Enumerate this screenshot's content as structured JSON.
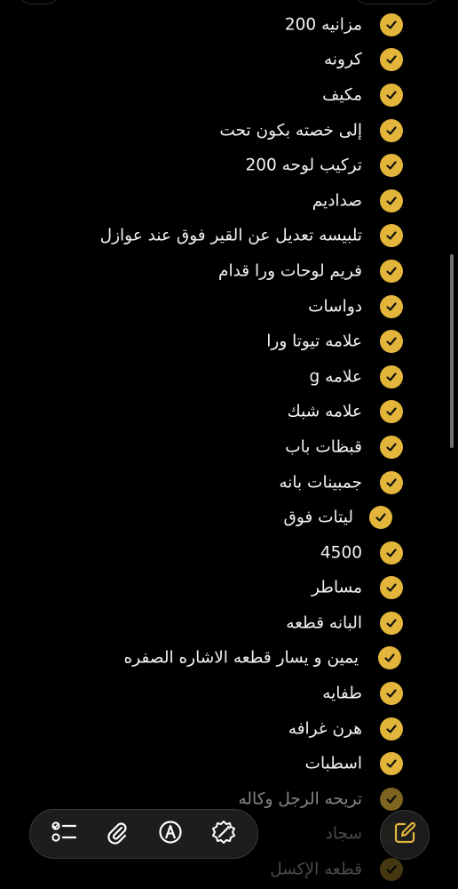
{
  "checklist": {
    "items": [
      {
        "label": "مزانيه 200"
      },
      {
        "label": "كرونه"
      },
      {
        "label": "مكيف"
      },
      {
        "label": "إلى خصته بكون تحت"
      },
      {
        "label": "تركيب لوحه 200"
      },
      {
        "label": "صداديم"
      },
      {
        "label": "تلبيسه تعديل عن القير فوق عند  عوازل"
      },
      {
        "label": "فريم لوحات ورا قدام"
      },
      {
        "label": "دواسات"
      },
      {
        "label": "علامه تيوتا ورا"
      },
      {
        "label": "علامه g"
      },
      {
        "label": "علامه شبك"
      },
      {
        "label": "قبظات باب"
      },
      {
        "label": "جمبينات بانه"
      },
      {
        "label": "ليتات فوق"
      },
      {
        "label": "4500"
      },
      {
        "label": "مساطر"
      },
      {
        "label": "البانه قطعه"
      },
      {
        "label": "يمين و يسار قطعه الاشاره الصفره"
      },
      {
        "label": "طفايه"
      },
      {
        "label": "هرن غرافه"
      },
      {
        "label": "اسطبات"
      },
      {
        "label": "تريحه الرجل وكاله"
      },
      {
        "label": "سجاد"
      },
      {
        "label": "قطعه الإكسل"
      }
    ],
    "check_color": "#e3b63b"
  },
  "toolbar": {
    "icons": [
      "checklist-icon",
      "paperclip-icon",
      "markup-pen-icon",
      "writing-tools-icon"
    ],
    "compose_icon": "compose-icon"
  }
}
